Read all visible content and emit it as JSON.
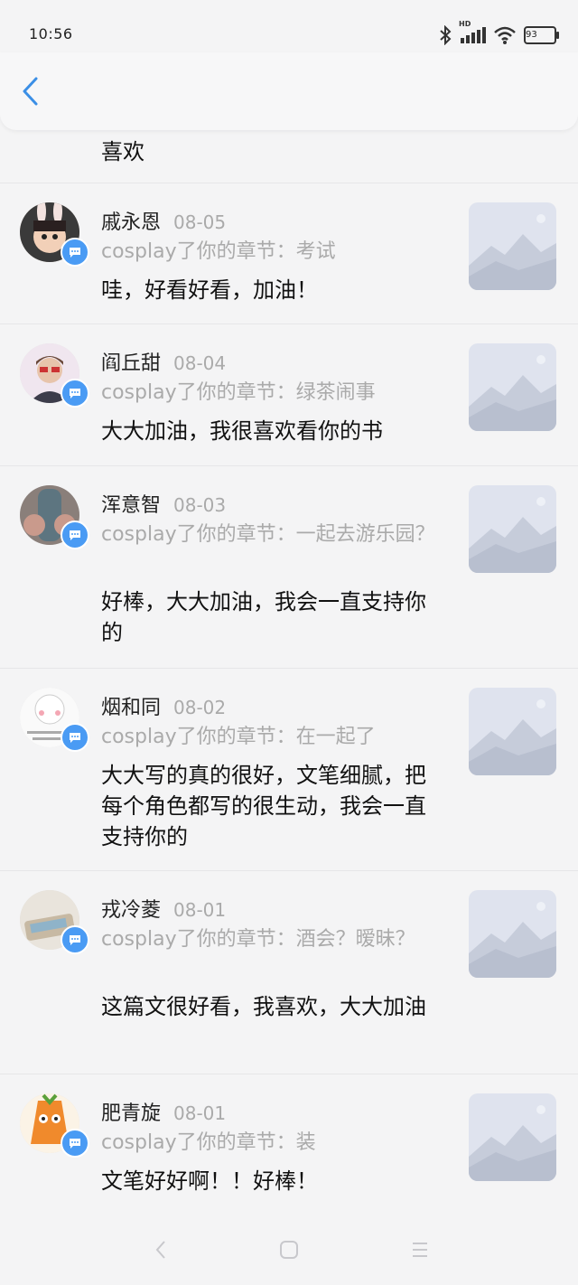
{
  "status": {
    "time": "10:56",
    "battery": "93",
    "network_label": "HD"
  },
  "header": {
    "back_icon": "chevron-left-icon"
  },
  "truncated_comment": "喜欢",
  "items": [
    {
      "name": "戚永恩",
      "date": "08-05",
      "chapter": "cosplay了你的章节：考试",
      "comment": "哇，好看好看，加油！"
    },
    {
      "name": "阎丘甜",
      "date": "08-04",
      "chapter": "cosplay了你的章节：绿茶闹事",
      "comment": "大大加油，我很喜欢看你的书"
    },
    {
      "name": "浑意智",
      "date": "08-03",
      "chapter": "cosplay了你的章节：一起去游乐园？",
      "comment": "好棒，大大加油，我会一直支持你的"
    },
    {
      "name": "烟和同",
      "date": "08-02",
      "chapter": "cosplay了你的章节：在一起了",
      "comment": "大大写的真的很好，文笔细腻，把每个角色都写的很生动，我会一直支持你的"
    },
    {
      "name": "戎冷菱",
      "date": "08-01",
      "chapter": "cosplay了你的章节：酒会？暧昧？",
      "comment": "这篇文很好看，我喜欢，大大加油"
    },
    {
      "name": "肥青旋",
      "date": "08-01",
      "chapter": "cosplay了你的章节：装",
      "comment": "文笔好好啊！！好棒！"
    }
  ],
  "colors": {
    "accent": "#4a9bf4",
    "muted": "#aaaaaa"
  }
}
